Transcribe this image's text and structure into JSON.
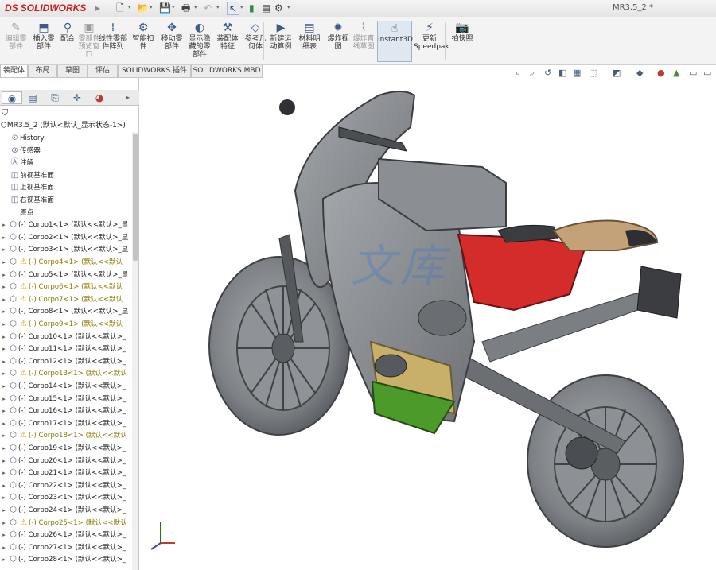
{
  "app": {
    "brand_prefix": "DS",
    "brand_name": "SOLIDWORKS",
    "doc_title": "MR3.5_2 *"
  },
  "quick_access": {
    "icons": [
      "new-document-icon",
      "open-icon",
      "save-icon",
      "print-icon",
      "undo-icon",
      "select-icon",
      "rebuild-icon",
      "options-icon"
    ]
  },
  "command_manager": {
    "buttons": [
      {
        "label": "编辑零\n部件",
        "icon": "edit-component-icon",
        "dim": true
      },
      {
        "label": "插入零\n部件",
        "icon": "insert-component-icon",
        "dim": false
      },
      {
        "label": "配合",
        "icon": "mate-icon",
        "dim": false
      },
      {
        "label": "零部件\n预览窗\n口",
        "icon": "preview-window-icon",
        "dim": true
      },
      {
        "label": "线性零部\n件阵列",
        "icon": "linear-pattern-icon",
        "dim": false
      },
      {
        "label": "智能扣\n件",
        "icon": "smart-fastener-icon",
        "dim": false
      },
      {
        "label": "移动零\n部件",
        "icon": "move-component-icon",
        "dim": false
      },
      {
        "label": "显示隐\n藏的零\n部件",
        "icon": "show-hidden-icon",
        "dim": false
      },
      {
        "label": "装配体\n特征",
        "icon": "assembly-feature-icon",
        "dim": false
      },
      {
        "label": "参考几\n何体",
        "icon": "reference-geometry-icon",
        "dim": false
      },
      {
        "label": "新建运\n动算例",
        "icon": "motion-study-icon",
        "dim": false
      },
      {
        "label": "材料明\n细表",
        "icon": "bom-icon",
        "dim": false
      },
      {
        "label": "爆炸视\n图",
        "icon": "exploded-view-icon",
        "dim": false
      },
      {
        "label": "爆炸直\n线草图",
        "icon": "explode-line-icon",
        "dim": true
      },
      {
        "label": "Instant3D",
        "icon": "instant3d-icon",
        "dim": false,
        "active": true
      },
      {
        "label": "更新\nSpeedpak",
        "icon": "speedpak-icon",
        "dim": false
      },
      {
        "label": "拍快照",
        "icon": "snapshot-icon",
        "dim": false
      }
    ]
  },
  "tabs": [
    {
      "label": "装配体",
      "active": true
    },
    {
      "label": "布局",
      "active": false
    },
    {
      "label": "草图",
      "active": false
    },
    {
      "label": "评估",
      "active": false
    },
    {
      "label": "SOLIDWORKS 插件",
      "active": false
    },
    {
      "label": "SOLIDWORKS MBD",
      "active": false
    }
  ],
  "view_toolbar": {
    "icons": [
      "zoom-fit-icon",
      "zoom-area-icon",
      "previous-view-icon",
      "section-view-icon",
      "dynamic-annotation-icon",
      "view-orientation-icon",
      "display-style-icon",
      "hide-show-icon",
      "edit-appearance-icon",
      "apply-scene-icon",
      "view-settings-icon",
      "monitor-icon"
    ]
  },
  "feature_manager": {
    "panel_tabs": [
      "feature-manager-icon",
      "property-manager-icon",
      "configuration-manager-icon",
      "dimxpert-icon",
      "display-manager-icon"
    ],
    "filter_icon": "filter-icon",
    "root_label": "MR3.5_2 (默认<默认_显示状态-1>)",
    "features": [
      {
        "label": "History",
        "icon": "history-icon"
      },
      {
        "label": "传感器",
        "icon": "sensor-icon"
      },
      {
        "label": "注解",
        "icon": "annotation-icon"
      },
      {
        "label": "前视基准面",
        "icon": "plane-icon"
      },
      {
        "label": "上视基准面",
        "icon": "plane-icon"
      },
      {
        "label": "右视基准面",
        "icon": "plane-icon"
      },
      {
        "label": "原点",
        "icon": "origin-icon"
      }
    ],
    "parts": [
      {
        "label": "(-) Corpo1<1> (默认<<默认>_显",
        "warn": false
      },
      {
        "label": "(-) Corpo2<1> (默认<<默认>_显",
        "warn": false
      },
      {
        "label": "(-) Corpo3<1> (默认<<默认>_显",
        "warn": false
      },
      {
        "label": "(-) Corpo4<1> (默认<<默认",
        "warn": true
      },
      {
        "label": "(-) Corpo5<1> (默认<<默认>_显",
        "warn": false
      },
      {
        "label": "(-) Corpo6<1> (默认<<默认",
        "warn": true
      },
      {
        "label": "(-) Corpo7<1> (默认<<默认",
        "warn": true
      },
      {
        "label": "(-) Corpo8<1> (默认<<默认>_显",
        "warn": false
      },
      {
        "label": "(-) Corpo9<1> (默认<<默认",
        "warn": true
      },
      {
        "label": "(-) Corpo10<1> (默认<<默认>_",
        "warn": false
      },
      {
        "label": "(-) Corpo11<1> (默认<<默认>_",
        "warn": false
      },
      {
        "label": "(-) Corpo12<1> (默认<<默认>_",
        "warn": false
      },
      {
        "label": "(-) Corpo13<1> (默认<<默认",
        "warn": true
      },
      {
        "label": "(-) Corpo14<1> (默认<<默认>_",
        "warn": false
      },
      {
        "label": "(-) Corpo15<1> (默认<<默认>_",
        "warn": false
      },
      {
        "label": "(-) Corpo16<1> (默认<<默认>_",
        "warn": false
      },
      {
        "label": "(-) Corpo17<1> (默认<<默认>_",
        "warn": false
      },
      {
        "label": "(-) Corpo18<1> (默认<<默认",
        "warn": true
      },
      {
        "label": "(-) Corpo19<1> (默认<<默认>_",
        "warn": false
      },
      {
        "label": "(-) Corpo20<1> (默认<<默认>_",
        "warn": false
      },
      {
        "label": "(-) Corpo21<1> (默认<<默认>_",
        "warn": false
      },
      {
        "label": "(-) Corpo22<1> (默认<<默认>_",
        "warn": false
      },
      {
        "label": "(-) Corpo23<1> (默认<<默认>_",
        "warn": false
      },
      {
        "label": "(-) Corpo24<1> (默认<<默认>_",
        "warn": false
      },
      {
        "label": "(-) Corpo25<1> (默认<<默认",
        "warn": true
      },
      {
        "label": "(-) Corpo26<1> (默认<<默认>_",
        "warn": false
      },
      {
        "label": "(-) Corpo27<1> (默认<<默认>_",
        "warn": false
      },
      {
        "label": "(-) Corpo28<1> (默认<<默认>_",
        "warn": false
      }
    ]
  },
  "viewport": {
    "watermark": "文库",
    "colors": {
      "body": "#8e9196",
      "red": "#d42b2b",
      "yellow": "#c9b06a",
      "green": "#4c9a2a",
      "tail": "#c3a27a"
    }
  }
}
